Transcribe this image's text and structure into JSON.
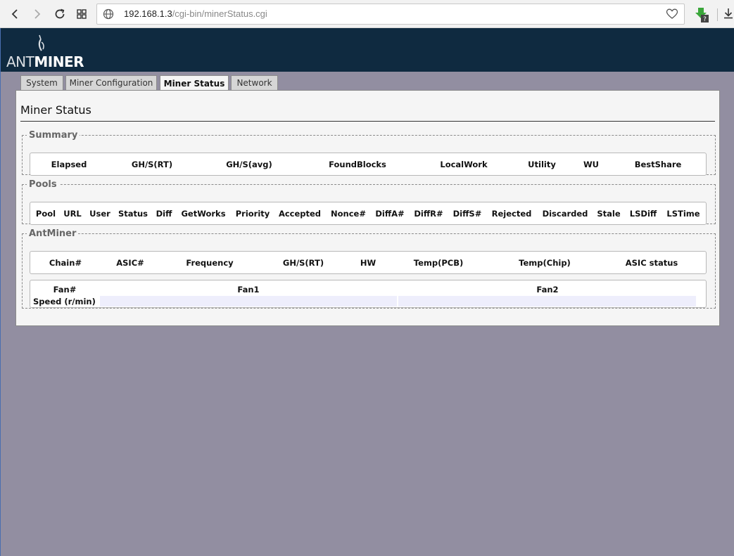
{
  "browser": {
    "url_host": "192.168.1.3",
    "url_path": "/cgi-bin/minerStatus.cgi"
  },
  "header": {
    "logo_light": "ANT",
    "logo_bold": "MINER",
    "bg_color": "#0f2a40"
  },
  "tabs": [
    {
      "label": "System",
      "active": false
    },
    {
      "label": "Miner Configuration",
      "active": false
    },
    {
      "label": "Miner Status",
      "active": true
    },
    {
      "label": "Network",
      "active": false
    }
  ],
  "page_title": "Miner Status",
  "summary": {
    "legend": "Summary",
    "columns": [
      "Elapsed",
      "GH/S(RT)",
      "GH/S(avg)",
      "FoundBlocks",
      "LocalWork",
      "Utility",
      "WU",
      "BestShare"
    ]
  },
  "pools": {
    "legend": "Pools",
    "columns": [
      "Pool",
      "URL",
      "User",
      "Status",
      "Diff",
      "GetWorks",
      "Priority",
      "Accepted",
      "Nonce#",
      "DiffA#",
      "DiffR#",
      "DiffS#",
      "Rejected",
      "Discarded",
      "Stale",
      "LSDiff",
      "LSTime"
    ]
  },
  "antminer": {
    "legend": "AntMiner",
    "columns": [
      "Chain#",
      "ASIC#",
      "Frequency",
      "GH/S(RT)",
      "HW",
      "Temp(PCB)",
      "Temp(Chip)",
      "ASIC status"
    ],
    "fan_header": [
      "Fan#",
      "Fan1",
      "Fan2"
    ],
    "speed_label": "Speed (r/min)",
    "fan_speeds": [
      "",
      ""
    ]
  }
}
